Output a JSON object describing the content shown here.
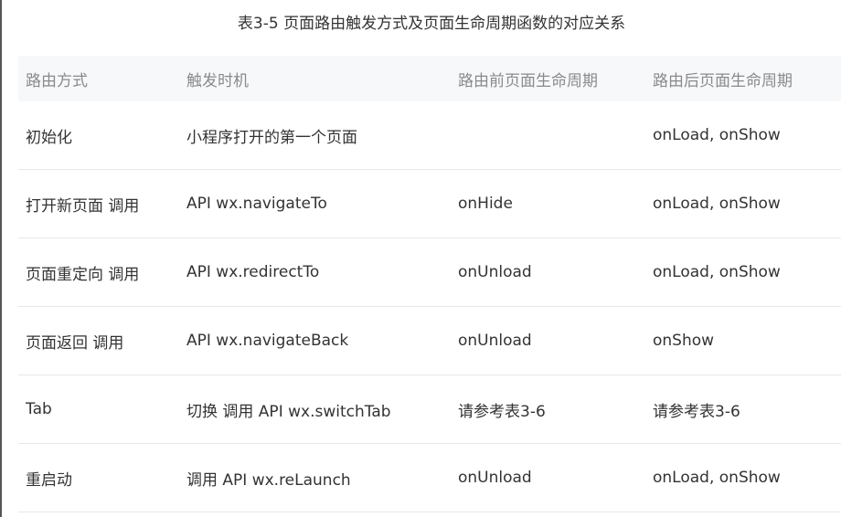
{
  "caption": "表3-5 页面路由触发方式及页面生命周期函数的对应关系",
  "table": {
    "headers": [
      "路由方式",
      "触发时机",
      "路由前页面生命周期",
      "路由后页面生命周期"
    ],
    "rows": [
      [
        "初始化",
        "小程序打开的第一个页面",
        "",
        "onLoad, onShow"
      ],
      [
        "打开新页面 调用",
        "API wx.navigateTo",
        "onHide",
        "onLoad, onShow"
      ],
      [
        "页面重定向 调用",
        "API wx.redirectTo",
        "onUnload",
        "onLoad, onShow"
      ],
      [
        "页面返回 调用",
        "API wx.navigateBack",
        "onUnload",
        "onShow"
      ],
      [
        "Tab",
        "切换 调用 API wx.switchTab",
        "请参考表3-6",
        "请参考表3-6"
      ],
      [
        "重启动",
        "调用 API wx.reLaunch",
        "onUnload",
        "onLoad, onShow"
      ]
    ]
  }
}
